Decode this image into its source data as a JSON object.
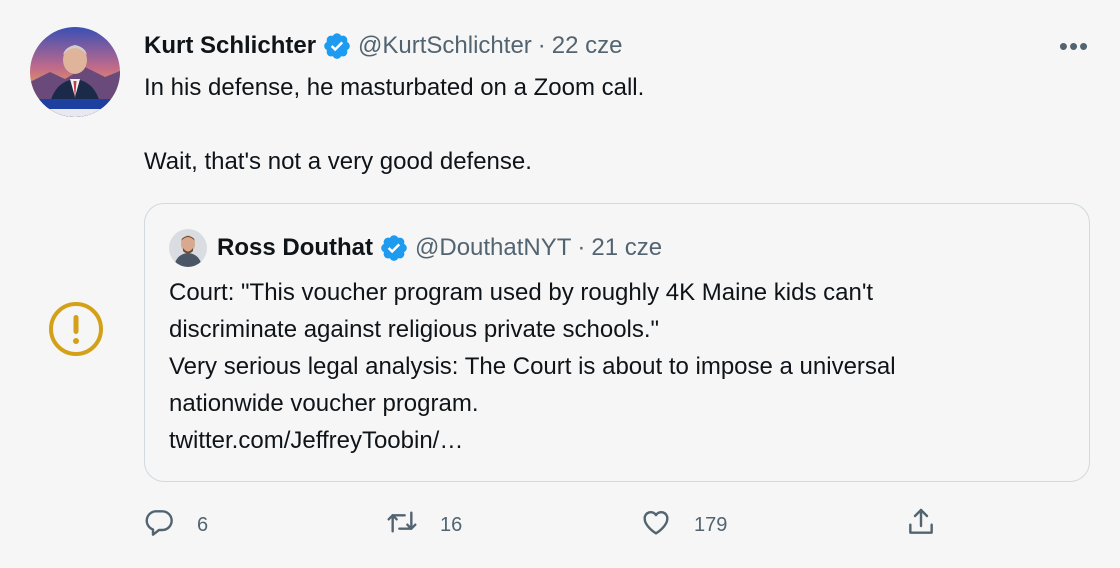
{
  "tweet": {
    "author_name": "Kurt Schlichter",
    "handle": "@KurtSchlichter",
    "separator": "·",
    "time": "22 cze",
    "more_label": "•••",
    "text_line1": "In his defense, he masturbated on a Zoom call.",
    "text_line2": "Wait, that's not a very good defense."
  },
  "quote": {
    "author_name": "Ross Douthat",
    "handle": "@DouthatNYT",
    "separator": "·",
    "time": "21 cze",
    "lines": [
      "Court: \"This voucher program used by roughly 4K Maine kids can't",
      "discriminate against religious private schools.\"",
      "Very serious legal analysis: The Court is about to impose a universal",
      "nationwide voucher program.",
      "twitter.com/JeffreyToobin/…"
    ]
  },
  "actions": {
    "replies": "6",
    "retweets": "16",
    "likes": "179"
  },
  "colors": {
    "verified": "#1d9bf0",
    "warning": "#d4a017",
    "muted": "#536471"
  },
  "icons": [
    "verified-badge-icon",
    "warning-icon",
    "reply-icon",
    "retweet-icon",
    "like-icon",
    "share-icon",
    "more-icon"
  ]
}
